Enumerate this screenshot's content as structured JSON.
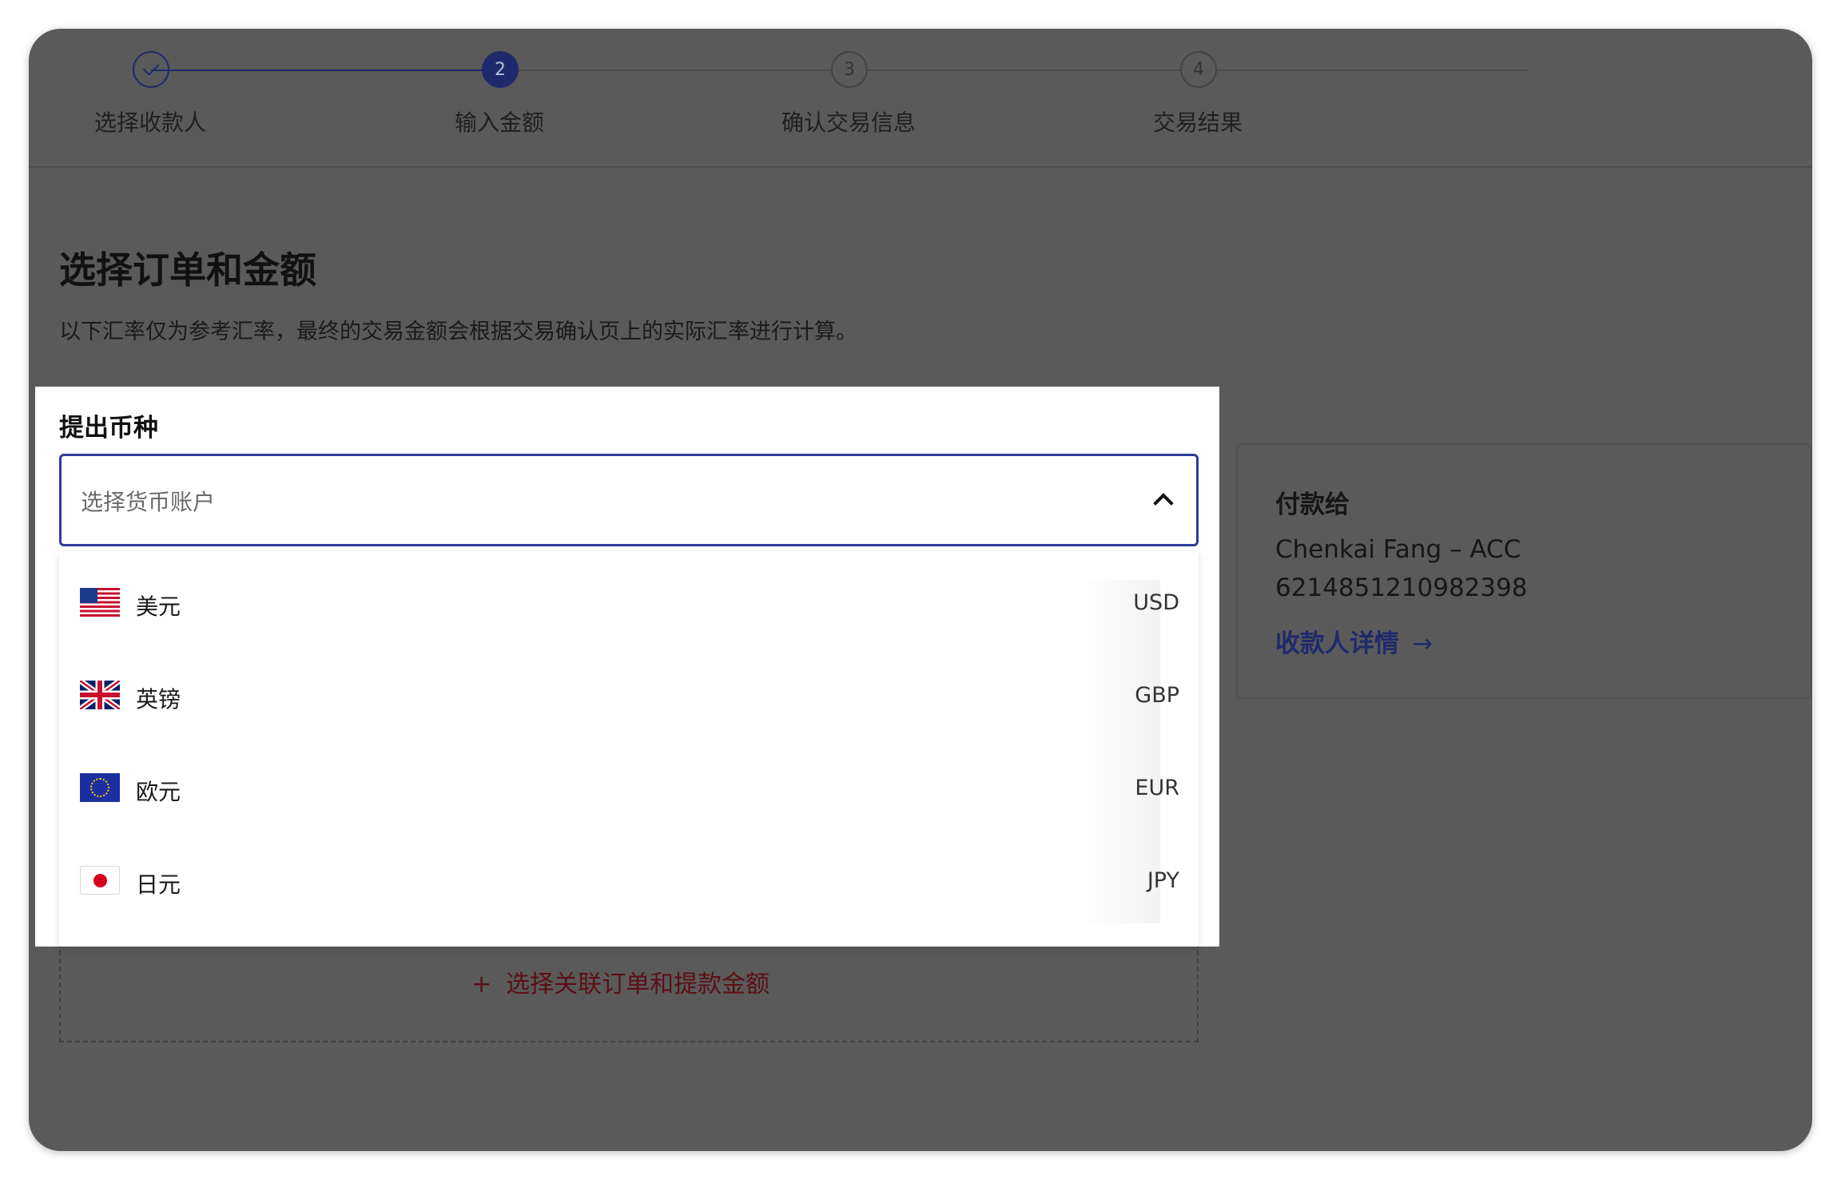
{
  "steps": [
    {
      "number": "1",
      "label": "选择收款人",
      "state": "done"
    },
    {
      "number": "2",
      "label": "输入金额",
      "state": "active"
    },
    {
      "number": "3",
      "label": "确认交易信息",
      "state": "pending"
    },
    {
      "number": "4",
      "label": "交易结果",
      "state": "pending"
    }
  ],
  "page": {
    "title": "选择订单和金额",
    "subtitle": "以下汇率仅为参考汇率，最终的交易金额会根据交易确认页上的实际汇率进行计算。"
  },
  "currency_select": {
    "label": "提出币种",
    "placeholder": "选择货币账户",
    "options": [
      {
        "name": "美元",
        "code": "USD",
        "flag": "us-flag-icon"
      },
      {
        "name": "英镑",
        "code": "GBP",
        "flag": "uk-flag-icon"
      },
      {
        "name": "欧元",
        "code": "EUR",
        "flag": "eu-flag-icon"
      },
      {
        "name": "日元",
        "code": "JPY",
        "flag": "jp-flag-icon"
      }
    ]
  },
  "payee": {
    "title": "付款给",
    "name": "Chenkai Fang – ACC",
    "account": "6214851210982398",
    "details_link": "收款人详情",
    "arrow": "→"
  },
  "order_link": {
    "plus": "+",
    "label": "选择关联订单和提款金额"
  },
  "colors": {
    "primary": "#1e2a6b",
    "focus_border": "#2f3b9a",
    "overlay": "#5a5a5a",
    "accent_red": "#5c0f14"
  }
}
